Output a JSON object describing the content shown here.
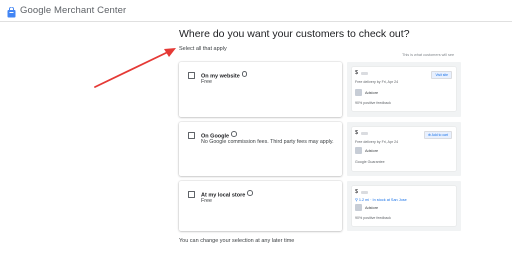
{
  "header": {
    "app_title": "Google Merchant Center",
    "logo_icon": "merchant-center-logo-icon"
  },
  "main": {
    "headline": "Where do you want your customers to check out?",
    "subtext": "Select all that apply",
    "preview_note": "This is what customers will see",
    "footer": "You can change your selection at any later time"
  },
  "options": [
    {
      "title": "On my website",
      "description": "Free",
      "checked": false,
      "preview": {
        "price": "$",
        "delivery": "Free delivery by Fri, Apr 24",
        "store": "Adstore",
        "meta": "90% positive feedback",
        "button": "Visit site"
      }
    },
    {
      "title": "On Google",
      "description": "No Google commission fees. Third party fees may apply.",
      "checked": false,
      "preview": {
        "price": "$",
        "delivery": "Free delivery by Fri, Apr 24",
        "store": "Adstore",
        "meta": "Google Guarantee",
        "button": "Add to cart"
      }
    },
    {
      "title": "At my local store",
      "description": "Free",
      "checked": false,
      "preview": {
        "price": "$",
        "location": "1.2 mi · In stock at San Jose",
        "store": "Adstore",
        "meta": "90% positive feedback"
      }
    }
  ],
  "colors": {
    "arrow": "#e53935",
    "accent": "#1a73e8",
    "preview_bg": "#f1f3f4"
  }
}
